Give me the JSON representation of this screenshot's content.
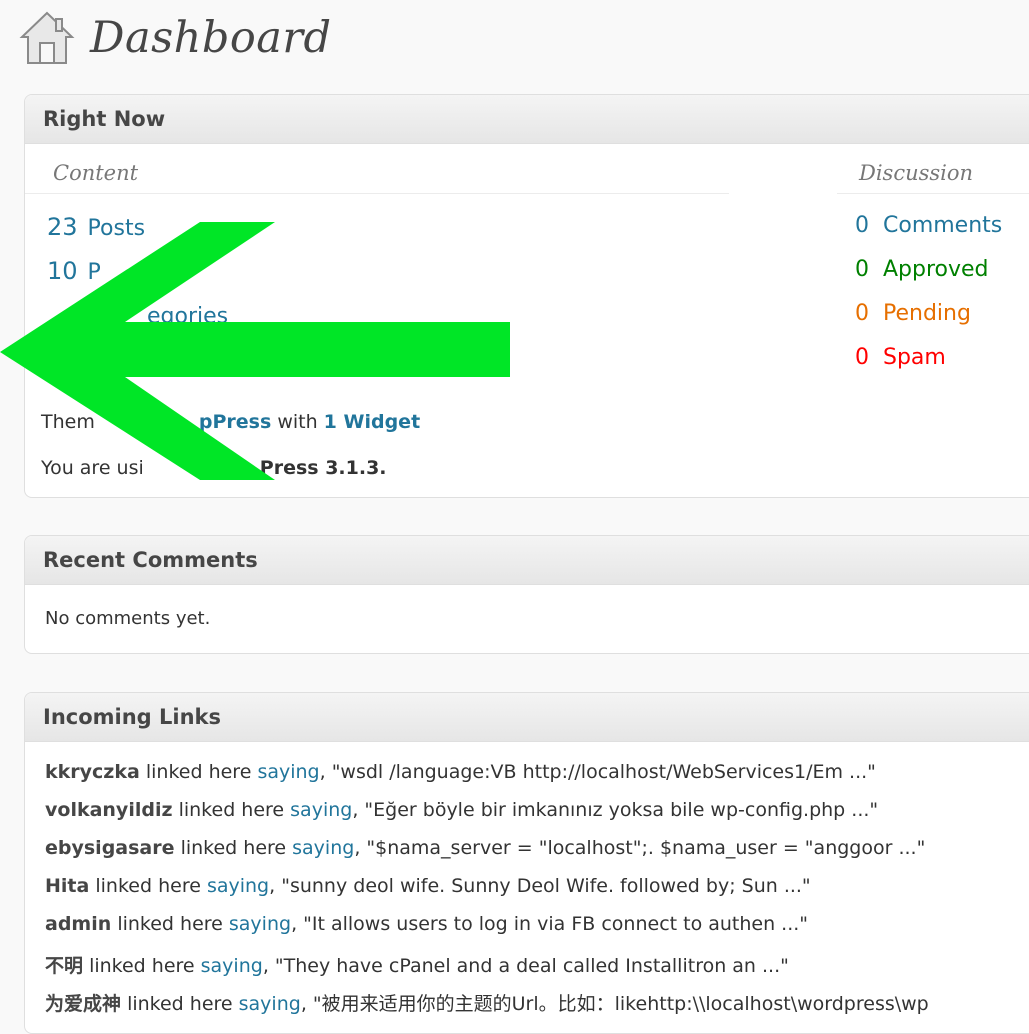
{
  "header": {
    "title": "Dashboard",
    "icon": "home-icon"
  },
  "right_now": {
    "title": "Right Now",
    "content_heading": "Content",
    "discussion_heading": "Discussion",
    "content": [
      {
        "count": "23",
        "label": "Posts"
      },
      {
        "count": "10",
        "label": "P"
      },
      {
        "count": "",
        "label": "egories"
      }
    ],
    "discussion": [
      {
        "count": "0",
        "label": "Comments"
      },
      {
        "count": "0",
        "label": "Approved"
      },
      {
        "count": "0",
        "label": "Pending"
      },
      {
        "count": "0",
        "label": "Spam"
      }
    ],
    "theme_prefix": "Them",
    "theme_name": "pPress",
    "theme_with": "with",
    "widget_link": "1 Widget",
    "version_prefix": "You are usi",
    "version_text": "Press 3.1.3."
  },
  "recent_comments": {
    "title": "Recent Comments",
    "empty_text": "No comments yet."
  },
  "incoming_links": {
    "title": "Incoming Links",
    "linked_text": "linked here",
    "saying_text": "saying",
    "items": [
      {
        "author": "kkryczka",
        "excerpt": ", \"wsdl /language:VB http://localhost/WebServices1/Em ...\""
      },
      {
        "author": "volkanyildiz",
        "excerpt": ", \"Eğer böyle bir imkanınız yoksa bile wp-config.php ...\""
      },
      {
        "author": "ebysigasare",
        "excerpt": ", \"$nama_server = \"localhost\";. $nama_user = \"anggoor ...\""
      },
      {
        "author": "Hita",
        "excerpt": ", \"sunny deol wife. Sunny Deol Wife. followed by; Sun ...\""
      },
      {
        "author": "admin",
        "excerpt": ", \"It allows users to log in via FB connect to authen ...\""
      },
      {
        "author": "不明",
        "excerpt": ", \"They have cPanel and a deal called Installitron an ...\""
      },
      {
        "author": "为爱成神",
        "excerpt": ", \"被用来适用你的主题的Url。比如：likehttp:\\\\localhost\\wordpress\\wp"
      }
    ]
  },
  "colors": {
    "link": "#21759b",
    "approved": "#008000",
    "pending": "#e66f00",
    "spam": "#ff0000",
    "arrow": "#00e626"
  }
}
